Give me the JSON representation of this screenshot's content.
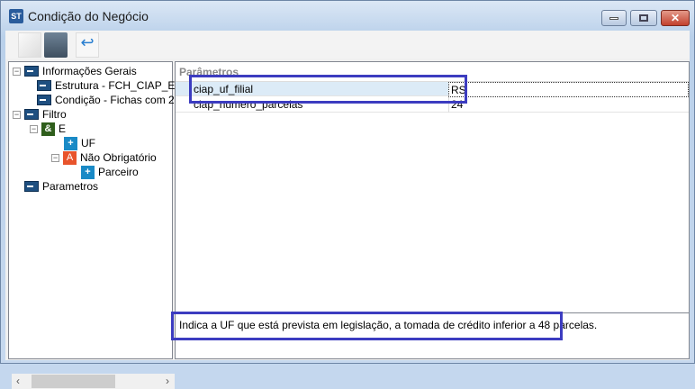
{
  "window": {
    "title": "Condição do Negócio",
    "app_icon": "ST"
  },
  "toolbar": {
    "buttons": [
      "new-document-icon",
      "save-icon",
      "undo-icon"
    ]
  },
  "tree": {
    "items": [
      {
        "label": "Informações Gerais"
      },
      {
        "label": "Estrutura - FCH_CIAP_E"
      },
      {
        "label": "Condição - Fichas com 2"
      },
      {
        "label": "Filtro"
      },
      {
        "label": "E",
        "badge": "&"
      },
      {
        "label": "UF",
        "badge": "+"
      },
      {
        "label": "Não Obrigatório",
        "badge": "A"
      },
      {
        "label": "Parceiro",
        "badge": "+"
      },
      {
        "label": "Parametros"
      }
    ]
  },
  "params": {
    "header": "Parâmetros",
    "rows": [
      {
        "name": "ciap_uf_filial",
        "value": "RS"
      },
      {
        "name": "ciap_numero_parcelas",
        "value": "24"
      }
    ]
  },
  "description": "Indica a UF que está prevista em legislação, a tomada de crédito inferior a 48 parcelas.",
  "colors": {
    "highlight": "#3c3cc0",
    "selected_row": "#dcebf7"
  }
}
